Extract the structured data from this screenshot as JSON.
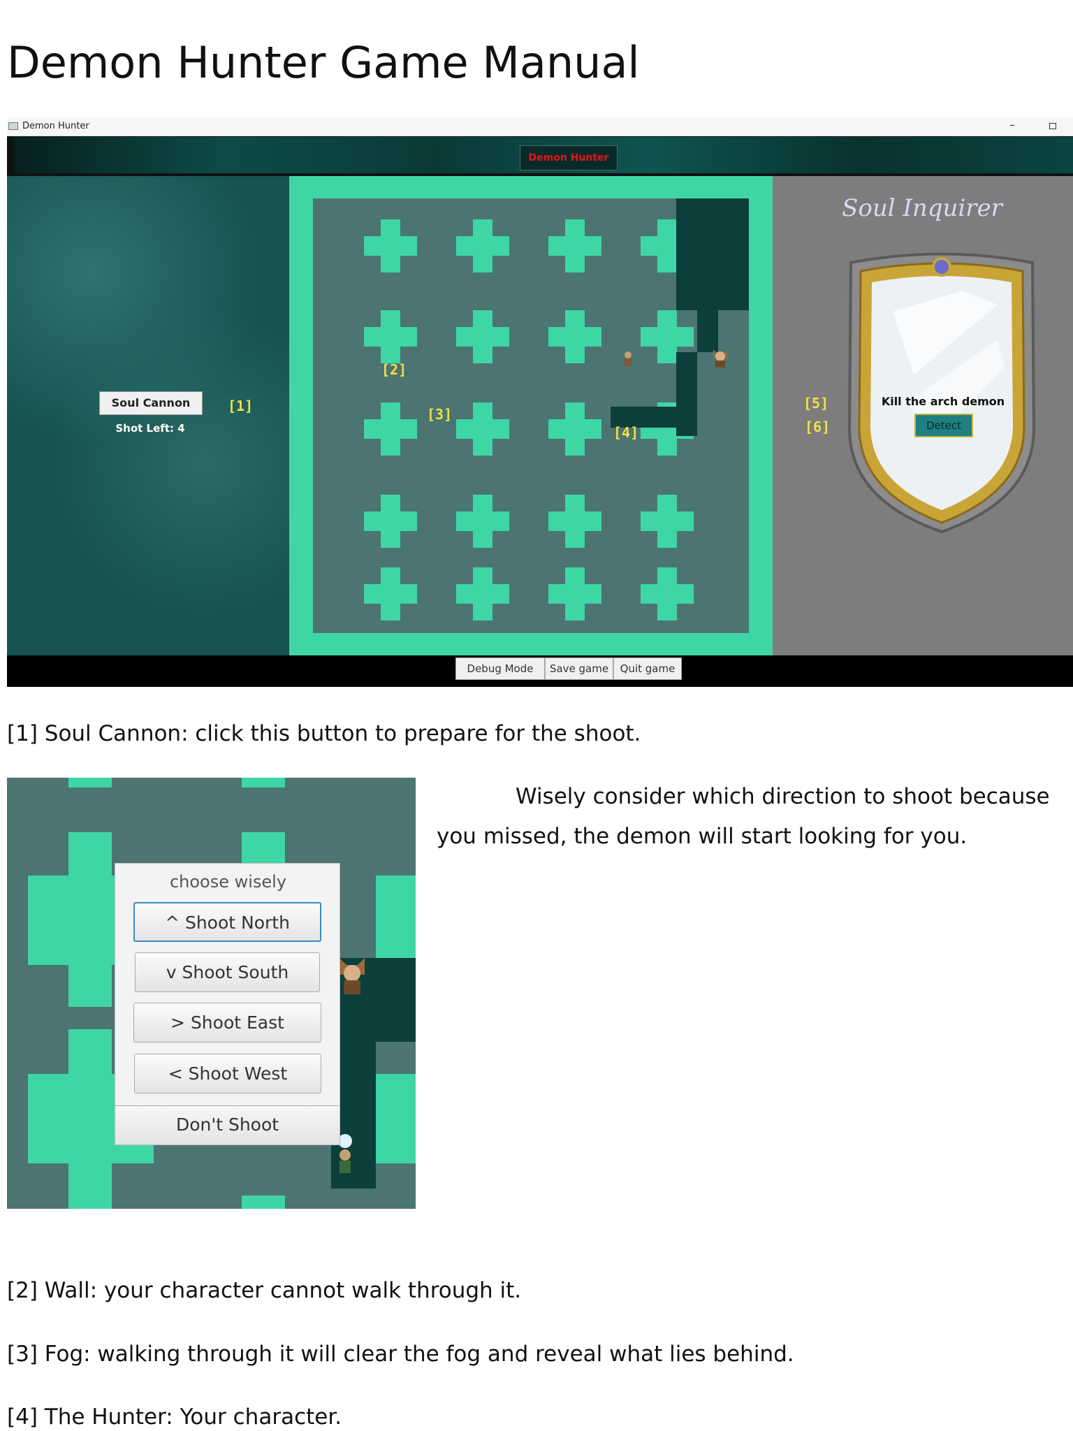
{
  "document": {
    "title": "Demon Hunter Game Manual"
  },
  "screenshot1": {
    "window_title": "Demon Hunter",
    "window_controls": {
      "minimize": "–"
    },
    "app_title": "Demon Hunter",
    "left_panel": {
      "soul_cannon_button": "Soul Cannon",
      "shots_left": "Shot Left: 4"
    },
    "labels": [
      "[1]",
      "[2]",
      "[3]",
      "[4]",
      "[5]",
      "[6]"
    ],
    "right_panel": {
      "heading": "Soul Inquirer",
      "message": "Kill the arch demon",
      "detect_button": "Detect"
    },
    "bottom_buttons": [
      "Debug Mode",
      "Save game",
      "Quit game"
    ]
  },
  "captions": {
    "item1": "[1] Soul Cannon: click this button to prepare for the shoot.",
    "item2": "[2] Wall: your character cannot walk through it.",
    "item3": "[3] Fog: walking through it will clear the fog and reveal what lies behind.",
    "item4": "[4] The Hunter: Your character."
  },
  "paragraph": {
    "line1": "Wisely consider which direction to shoot because",
    "line2": "you missed, the demon will start looking for you."
  },
  "screenshot2": {
    "dialog_title": "choose wisely",
    "options": [
      "^ Shoot North",
      "v Shoot South",
      "> Shoot East",
      "< Shoot West"
    ],
    "dont_shoot": "Don't Shoot"
  },
  "colors": {
    "wall": "#3fd6a6",
    "fog": "#4b7472",
    "revealed": "#0c3e3c",
    "label_yellow": "#f3e142",
    "app_title_red": "#e01818"
  }
}
